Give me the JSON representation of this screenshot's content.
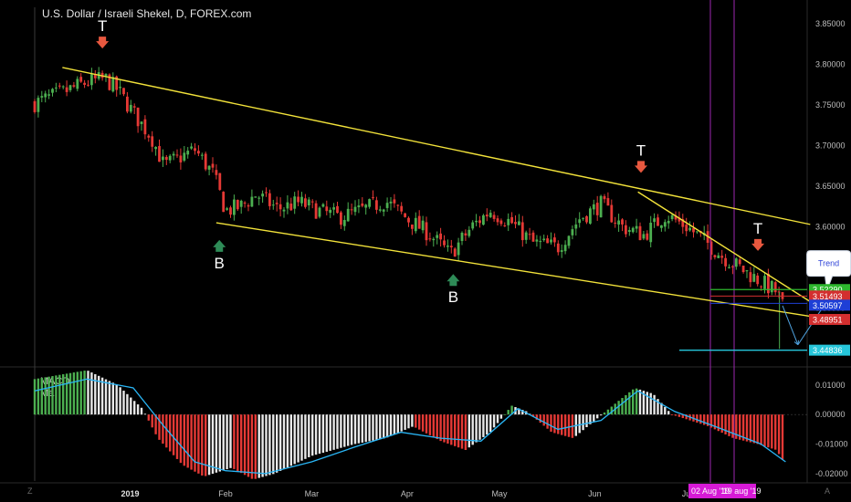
{
  "title": "U.S. Dollar / Israeli Shekel, D, FOREX.com",
  "corner_left": "Z",
  "corner_right": "A",
  "macd": {
    "label": "MACD",
    "signal_label": "Ma"
  },
  "colors": {
    "up": "#4caf50",
    "down": "#e53935",
    "channel": "#f2e23a",
    "marker_top": "#e8583f",
    "marker_bottom": "#2e8b57",
    "signal": "#29b6f6",
    "magenta": "#9c27b0"
  },
  "chart_data": [
    {
      "type": "candlestick",
      "symbol": "USDILS",
      "timeframe": "D",
      "y_ticks": [
        "3.85000",
        "3.80000",
        "3.75000",
        "3.70000",
        "3.65000",
        "3.60000",
        "3.55000",
        "3.50000",
        "3.45000"
      ],
      "ylim": [
        3.43,
        3.87
      ],
      "x_ticks": [
        "2019",
        "Feb",
        "Mar",
        "Apr",
        "May",
        "Jun",
        "Jul"
      ],
      "date_range": [
        "2018-12-01",
        "2019-08-09"
      ],
      "close_series": [
        [
          "2018-12-01",
          3.752
        ],
        [
          "2018-12-10",
          3.765
        ],
        [
          "2018-12-18",
          3.778
        ],
        [
          "2018-12-24",
          3.782
        ],
        [
          "2018-12-28",
          3.768
        ],
        [
          "2019-01-03",
          3.735
        ],
        [
          "2019-01-08",
          3.71
        ],
        [
          "2019-01-12",
          3.675
        ],
        [
          "2019-01-17",
          3.685
        ],
        [
          "2019-01-22",
          3.695
        ],
        [
          "2019-01-28",
          3.665
        ],
        [
          "2019-02-01",
          3.62
        ],
        [
          "2019-02-06",
          3.625
        ],
        [
          "2019-02-11",
          3.64
        ],
        [
          "2019-02-18",
          3.622
        ],
        [
          "2019-02-25",
          3.63
        ],
        [
          "2019-03-03",
          3.62
        ],
        [
          "2019-03-10",
          3.612
        ],
        [
          "2019-03-17",
          3.62
        ],
        [
          "2019-03-25",
          3.632
        ],
        [
          "2019-04-01",
          3.61
        ],
        [
          "2019-04-08",
          3.592
        ],
        [
          "2019-04-15",
          3.566
        ],
        [
          "2019-04-22",
          3.6
        ],
        [
          "2019-04-28",
          3.62
        ],
        [
          "2019-05-05",
          3.605
        ],
        [
          "2019-05-12",
          3.58
        ],
        [
          "2019-05-20",
          3.575
        ],
        [
          "2019-05-27",
          3.61
        ],
        [
          "2019-06-03",
          3.628
        ],
        [
          "2019-06-10",
          3.6
        ],
        [
          "2019-06-17",
          3.59
        ],
        [
          "2019-06-24",
          3.615
        ],
        [
          "2019-07-01",
          3.6
        ],
        [
          "2019-07-06",
          3.585
        ],
        [
          "2019-07-12",
          3.565
        ],
        [
          "2019-07-18",
          3.55
        ],
        [
          "2019-07-24",
          3.535
        ],
        [
          "2019-07-30",
          3.52
        ],
        [
          "2019-08-02",
          3.495
        ]
      ],
      "price_labels": [
        {
          "text": "3.52290",
          "color": "#2eb82e"
        },
        {
          "text": "3.51493",
          "color": "#d32f2f"
        },
        {
          "text": "3.50597",
          "color": "#1e3fd6"
        },
        {
          "text": "3.48951",
          "color": "#d32f2f"
        },
        {
          "text": "3.44836",
          "color": "#26c6da"
        }
      ],
      "channel_upper": [
        [
          "2018-12-10",
          3.796
        ],
        [
          "2019-08-10",
          3.603
        ]
      ],
      "channel_lower": [
        [
          "2019-01-29",
          3.605
        ],
        [
          "2019-08-10",
          3.49
        ]
      ],
      "trendline_inner": [
        [
          "2019-06-15",
          3.643
        ],
        [
          "2019-08-10",
          3.508
        ]
      ],
      "annotations": [
        {
          "text": "T",
          "kind": "top",
          "date": "2018-12-23",
          "price": 3.825
        },
        {
          "text": "B",
          "kind": "bottom",
          "date": "2019-01-30",
          "price": 3.575
        },
        {
          "text": "B",
          "kind": "bottom",
          "date": "2019-04-16",
          "price": 3.533
        },
        {
          "text": "T",
          "kind": "top",
          "date": "2019-06-16",
          "price": 3.672
        },
        {
          "text": "T",
          "kind": "top",
          "date": "2019-07-24",
          "price": 3.576
        }
      ],
      "callout": {
        "text": "Trend",
        "date": "2019-08-16",
        "price": 3.555
      },
      "date_labels": [
        "02 Aug '19",
        "'19 aug '19"
      ]
    },
    {
      "type": "histogram",
      "name": "MACD",
      "y_ticks": [
        "0.01000",
        "0.00000",
        "-0.01000",
        "-0.02000"
      ],
      "ylim": [
        -0.0225,
        0.0155
      ],
      "histogram_series": [
        [
          "2018-12-01",
          0.012
        ],
        [
          "2018-12-18",
          0.015
        ],
        [
          "2018-12-28",
          0.01
        ],
        [
          "2019-01-05",
          0.002
        ],
        [
          "2019-01-10",
          -0.008
        ],
        [
          "2019-01-18",
          -0.017
        ],
        [
          "2019-01-25",
          -0.021
        ],
        [
          "2019-02-03",
          -0.018
        ],
        [
          "2019-02-10",
          -0.022
        ],
        [
          "2019-02-17",
          -0.02
        ],
        [
          "2019-03-01",
          -0.014
        ],
        [
          "2019-03-15",
          -0.01
        ],
        [
          "2019-03-25",
          -0.008
        ],
        [
          "2019-04-03",
          -0.004
        ],
        [
          "2019-04-12",
          -0.009
        ],
        [
          "2019-04-20",
          -0.012
        ],
        [
          "2019-04-28",
          -0.006
        ],
        [
          "2019-05-05",
          0.003
        ],
        [
          "2019-05-10",
          0.001
        ],
        [
          "2019-05-18",
          -0.006
        ],
        [
          "2019-05-25",
          -0.008
        ],
        [
          "2019-06-01",
          -0.002
        ],
        [
          "2019-06-08",
          0.004
        ],
        [
          "2019-06-14",
          0.009
        ],
        [
          "2019-06-20",
          0.007
        ],
        [
          "2019-06-26",
          0.0
        ],
        [
          "2019-07-02",
          -0.002
        ],
        [
          "2019-07-08",
          -0.004
        ],
        [
          "2019-07-16",
          -0.008
        ],
        [
          "2019-07-24",
          -0.01
        ],
        [
          "2019-07-30",
          -0.012
        ],
        [
          "2019-08-02",
          -0.017
        ]
      ],
      "signal_series": [
        [
          "2018-12-01",
          0.008
        ],
        [
          "2018-12-18",
          0.012
        ],
        [
          "2019-01-02",
          0.009
        ],
        [
          "2019-01-12",
          -0.004
        ],
        [
          "2019-01-22",
          -0.016
        ],
        [
          "2019-02-01",
          -0.019
        ],
        [
          "2019-02-14",
          -0.02
        ],
        [
          "2019-03-01",
          -0.016
        ],
        [
          "2019-03-15",
          -0.011
        ],
        [
          "2019-03-30",
          -0.006
        ],
        [
          "2019-04-12",
          -0.008
        ],
        [
          "2019-04-25",
          -0.009
        ],
        [
          "2019-05-07",
          0.002
        ],
        [
          "2019-05-20",
          -0.005
        ],
        [
          "2019-06-03",
          -0.002
        ],
        [
          "2019-06-15",
          0.008
        ],
        [
          "2019-06-27",
          0.001
        ],
        [
          "2019-07-10",
          -0.004
        ],
        [
          "2019-07-25",
          -0.01
        ],
        [
          "2019-08-02",
          -0.016
        ]
      ]
    }
  ]
}
